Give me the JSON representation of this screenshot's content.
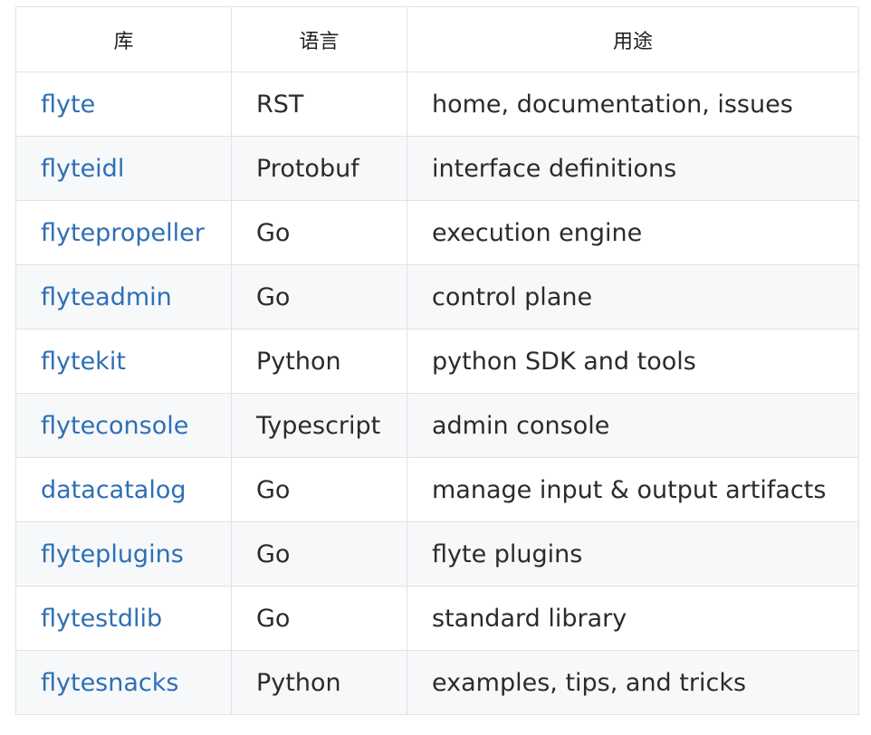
{
  "table": {
    "headers": [
      "库",
      "语言",
      "用途"
    ],
    "rows": [
      {
        "repo": "flyte",
        "language": "RST",
        "purpose": "home, documentation, issues"
      },
      {
        "repo": "flyteidl",
        "language": "Protobuf",
        "purpose": "interface definitions"
      },
      {
        "repo": "flytepropeller",
        "language": "Go",
        "purpose": "execution engine"
      },
      {
        "repo": "flyteadmin",
        "language": "Go",
        "purpose": "control plane"
      },
      {
        "repo": "flytekit",
        "language": "Python",
        "purpose": "python SDK and tools"
      },
      {
        "repo": "flyteconsole",
        "language": "Typescript",
        "purpose": "admin console"
      },
      {
        "repo": "datacatalog",
        "language": "Go",
        "purpose": "manage input & output artifacts"
      },
      {
        "repo": "flyteplugins",
        "language": "Go",
        "purpose": "flyte plugins"
      },
      {
        "repo": "flytestdlib",
        "language": "Go",
        "purpose": "standard library"
      },
      {
        "repo": "flytesnacks",
        "language": "Python",
        "purpose": "examples, tips, and tricks"
      }
    ]
  },
  "colors": {
    "link": "#2e6fb5",
    "text": "#2b2b2b",
    "stripe": "#f6f8fa",
    "border": "#dfe2e5"
  }
}
